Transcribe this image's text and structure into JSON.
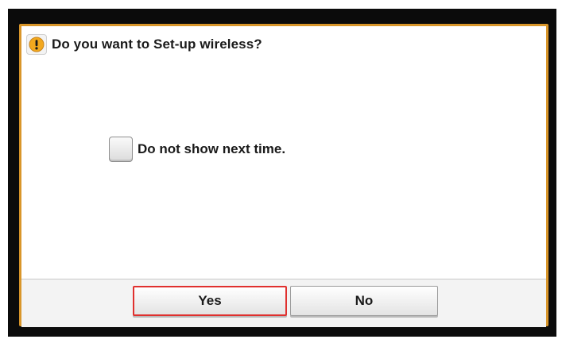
{
  "dialog": {
    "title": "Do you want to Set-up wireless?",
    "icon": "warning-icon",
    "checkbox_label": "Do not show next time.",
    "checkbox_checked": false,
    "yes_label": "Yes",
    "no_label": "No",
    "focused_button": "yes"
  },
  "colors": {
    "dialog_border": "#d9962a",
    "warning_icon": "#f2a81e",
    "focus_outline": "#e0302e",
    "bezel": "#0b0b0b"
  }
}
